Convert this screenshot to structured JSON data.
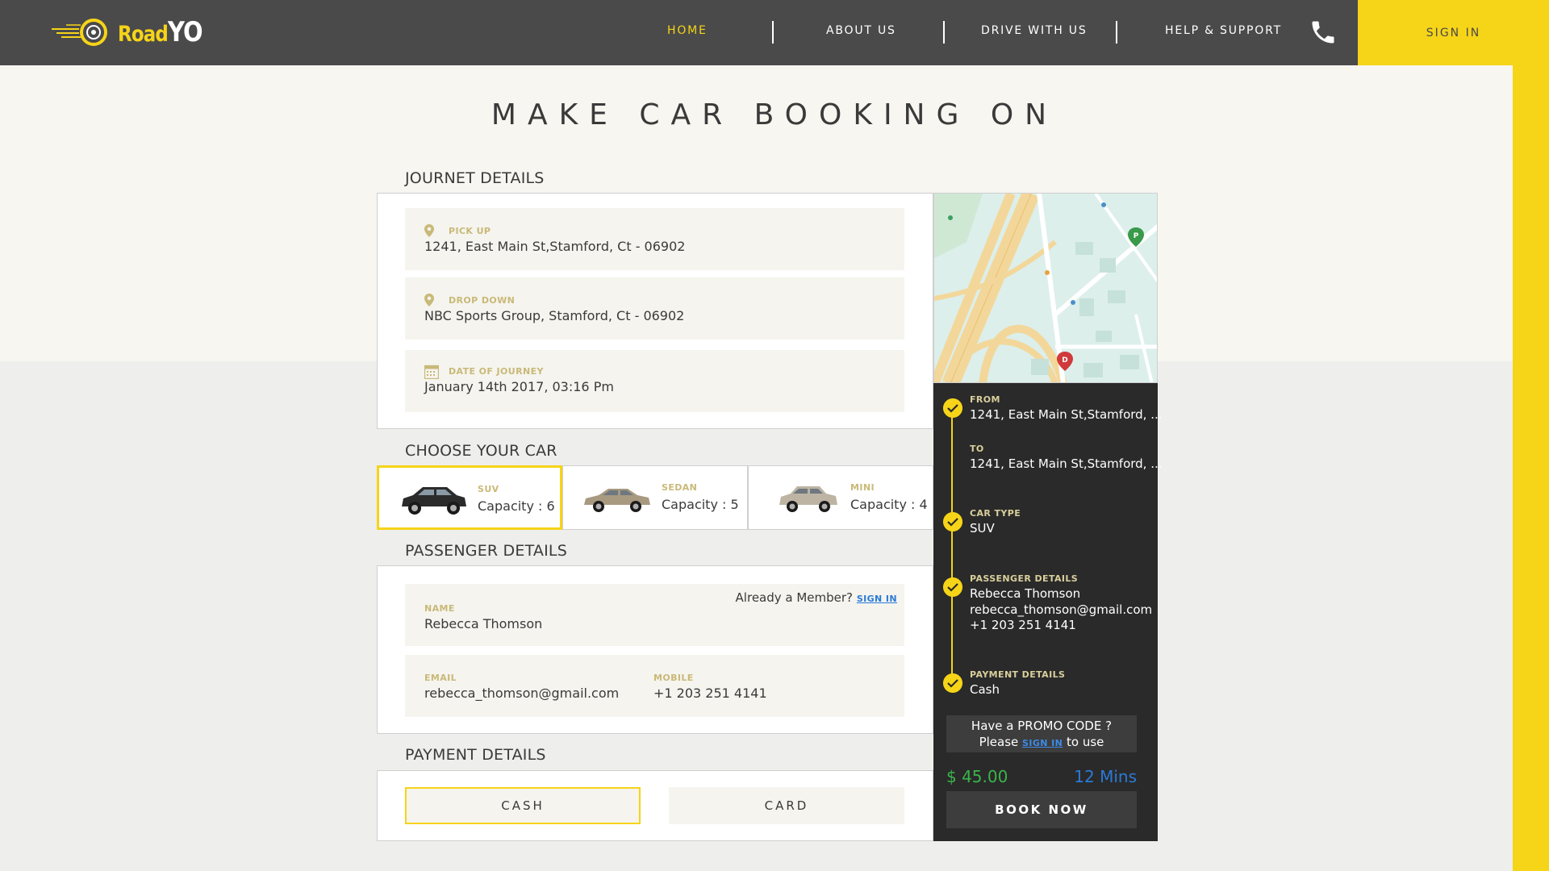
{
  "brand": {
    "road": "Road",
    "yo": "YO"
  },
  "nav": {
    "items": [
      {
        "label": "HOME",
        "active": true
      },
      {
        "label": "ABOUT US"
      },
      {
        "label": "DRIVE WITH US"
      },
      {
        "label": "HELP & SUPPORT"
      }
    ],
    "phone_icon": "phone-icon",
    "sign_in": "SIGN IN"
  },
  "page_title": "MAKE CAR BOOKING ON",
  "journey": {
    "title": "JOURNET DETAILS",
    "pickup": {
      "label": "PICK UP",
      "value": "1241, East Main St,Stamford, Ct - 06902",
      "icon": "map-pin-icon"
    },
    "dropdown": {
      "label": "DROP DOWN",
      "value": "NBC Sports Group, Stamford, Ct - 06902",
      "icon": "map-pin-icon"
    },
    "date": {
      "label": "DATE OF JOURNEY",
      "value": "January 14th 2017, 03:16 Pm",
      "icon": "calendar-icon"
    }
  },
  "cars": {
    "title": "CHOOSE YOUR CAR",
    "options": [
      {
        "type": "SUV",
        "capacity": "Capacity : 6",
        "selected": true
      },
      {
        "type": "SEDAN",
        "capacity": "Capacity : 5"
      },
      {
        "type": "MINI",
        "capacity": "Capacity : 4"
      }
    ]
  },
  "passenger": {
    "title": "PASSENGER DETAILS",
    "member_text": "Already a Member?",
    "sign_in": "SIGN IN",
    "name_label": "NAME",
    "name_value": "Rebecca Thomson",
    "email_label": "EMAIL",
    "email_value": "rebecca_thomson@gmail.com",
    "mobile_label": "MOBILE",
    "mobile_value": "+1 203 251 4141"
  },
  "payment": {
    "title": "PAYMENT DETAILS",
    "cash": "CASH",
    "card": "CARD",
    "selected": "CASH"
  },
  "summary": {
    "from_label": "FROM",
    "from_value": "1241, East Main St,Stamford, ...",
    "to_label": "TO",
    "to_value": "1241, East Main St,Stamford, ...",
    "car_label": "CAR TYPE",
    "car_value": "SUV",
    "passenger_label": "PASSENGER DETAILS",
    "passenger_name": "Rebecca Thomson",
    "passenger_email": "rebecca_thomson@gmail.com",
    "passenger_mobile": "+1 203 251 4141",
    "payment_label": "PAYMENT DETAILS",
    "payment_value": "Cash",
    "promo_line1": "Have a PROMO CODE ?",
    "promo_please": "Please",
    "promo_signin": "SIGN IN",
    "promo_to_use": "to use",
    "price": "$ 45.00",
    "eta": "12 Mins",
    "book_now": "BOOK NOW"
  },
  "colors": {
    "accent": "#f6d418",
    "nav_bg": "#4a4a4a",
    "summary_bg": "#2a2a2a",
    "price": "#39b54a",
    "link": "#2a7ad8"
  },
  "map": {
    "start_marker": "P",
    "end_marker": "D"
  }
}
